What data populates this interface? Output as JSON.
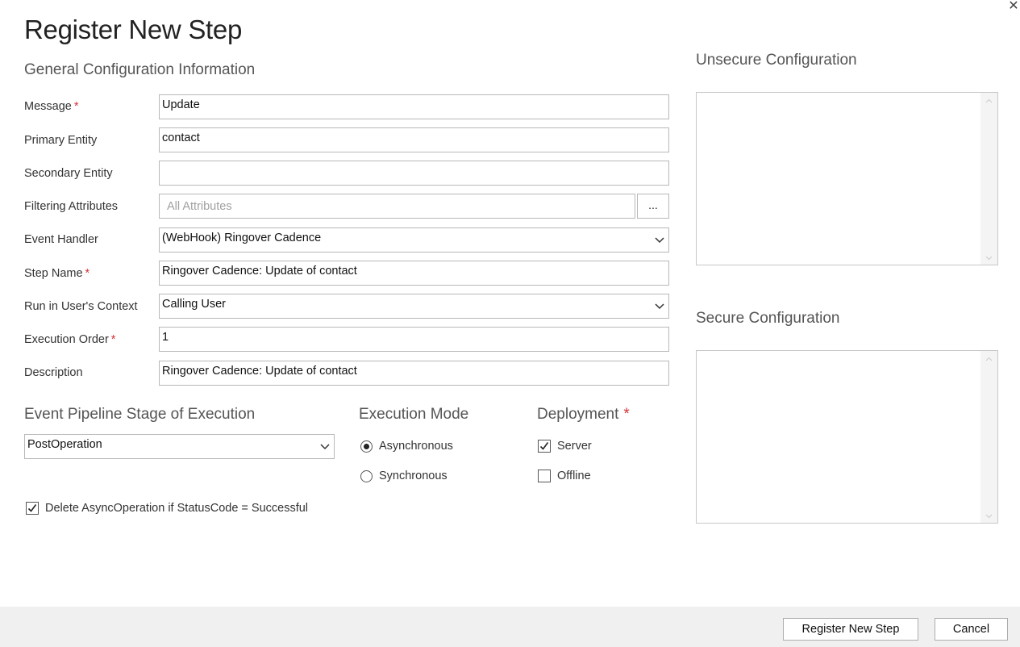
{
  "dialog": {
    "title": "Register New Step",
    "close_icon": "close-icon"
  },
  "general": {
    "heading": "General Configuration Information",
    "message": {
      "label": "Message",
      "required": "*",
      "value": "Update"
    },
    "primary_entity": {
      "label": "Primary Entity",
      "value": "contact"
    },
    "secondary_entity": {
      "label": "Secondary Entity",
      "value": ""
    },
    "filtering_attributes": {
      "label": "Filtering Attributes",
      "placeholder": "All Attributes",
      "browse_label": "..."
    },
    "event_handler": {
      "label": "Event Handler",
      "value": "(WebHook) Ringover Cadence"
    },
    "step_name": {
      "label": "Step Name",
      "required": "*",
      "value": "Ringover Cadence: Update of contact"
    },
    "run_context": {
      "label": "Run in User's Context",
      "value": "Calling User"
    },
    "execution_order": {
      "label": "Execution Order",
      "required": "*",
      "value": "1"
    },
    "description": {
      "label": "Description",
      "value": "Ringover Cadence: Update of contact"
    }
  },
  "pipeline": {
    "heading": "Event Pipeline Stage of Execution",
    "value": "PostOperation"
  },
  "execution_mode": {
    "heading": "Execution Mode",
    "options": [
      {
        "label": "Asynchronous",
        "selected": true
      },
      {
        "label": "Synchronous",
        "selected": false
      }
    ]
  },
  "deployment": {
    "heading": "Deployment",
    "required": "*",
    "options": [
      {
        "label": "Server",
        "checked": true
      },
      {
        "label": "Offline",
        "checked": false
      }
    ]
  },
  "delete_async": {
    "label": "Delete AsyncOperation if StatusCode = Successful",
    "checked": true
  },
  "unsecure_config": {
    "heading": "Unsecure  Configuration",
    "value": ""
  },
  "secure_config": {
    "heading": "Secure  Configuration",
    "value": ""
  },
  "footer": {
    "register_label": "Register New Step",
    "cancel_label": "Cancel"
  },
  "colors": {
    "required": "#d13438",
    "footer_bg": "#f0f0f0",
    "border": "#b8b8b8"
  }
}
